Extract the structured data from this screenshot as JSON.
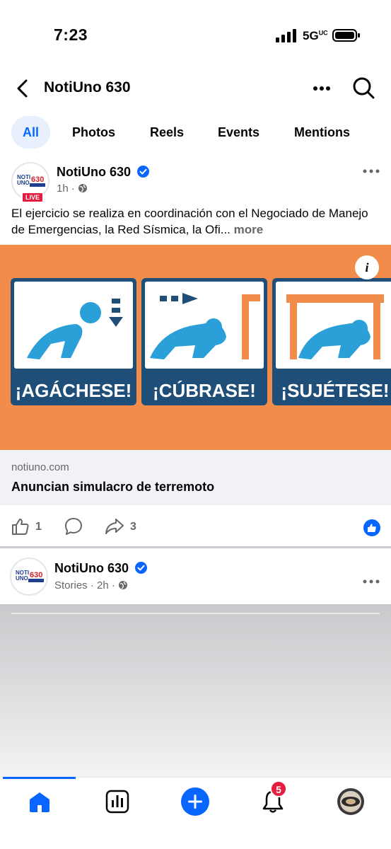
{
  "status_bar": {
    "time": "7:23",
    "network": "5G",
    "network_sup": "UC"
  },
  "header": {
    "title": "NotiUno 630"
  },
  "tabs": [
    {
      "label": "All",
      "active": true
    },
    {
      "label": "Photos"
    },
    {
      "label": "Reels"
    },
    {
      "label": "Events"
    },
    {
      "label": "Mentions"
    }
  ],
  "post1": {
    "author": "NotiUno 630",
    "live_badge": "LIVE",
    "time": "1h",
    "text": "El ejercicio se realiza en coordinación con el Negociado de Manejo de Emergencias, la Red Sísmica, la Ofi...",
    "see_more": "more",
    "media_labels": [
      "¡AGÁCHESE!",
      "¡CÚBRASE!",
      "¡SUJÉTESE!"
    ],
    "link_domain": "notiuno.com",
    "link_title": "Anuncian simulacro de terremoto",
    "like_count": "1",
    "share_count": "3"
  },
  "post2": {
    "author": "NotiUno 630",
    "meta_source": "Stories",
    "time": "2h"
  },
  "bottom_nav": {
    "notification_count": "5"
  },
  "colors": {
    "accent": "#0866ff",
    "media_bg": "#f28c4a",
    "panel_blue": "#1f4e79",
    "figure_blue": "#2a9fd8",
    "badge_red": "#e41e3f"
  },
  "logo": {
    "line1": "NOTI",
    "line2": "UNO",
    "line3": "630"
  }
}
